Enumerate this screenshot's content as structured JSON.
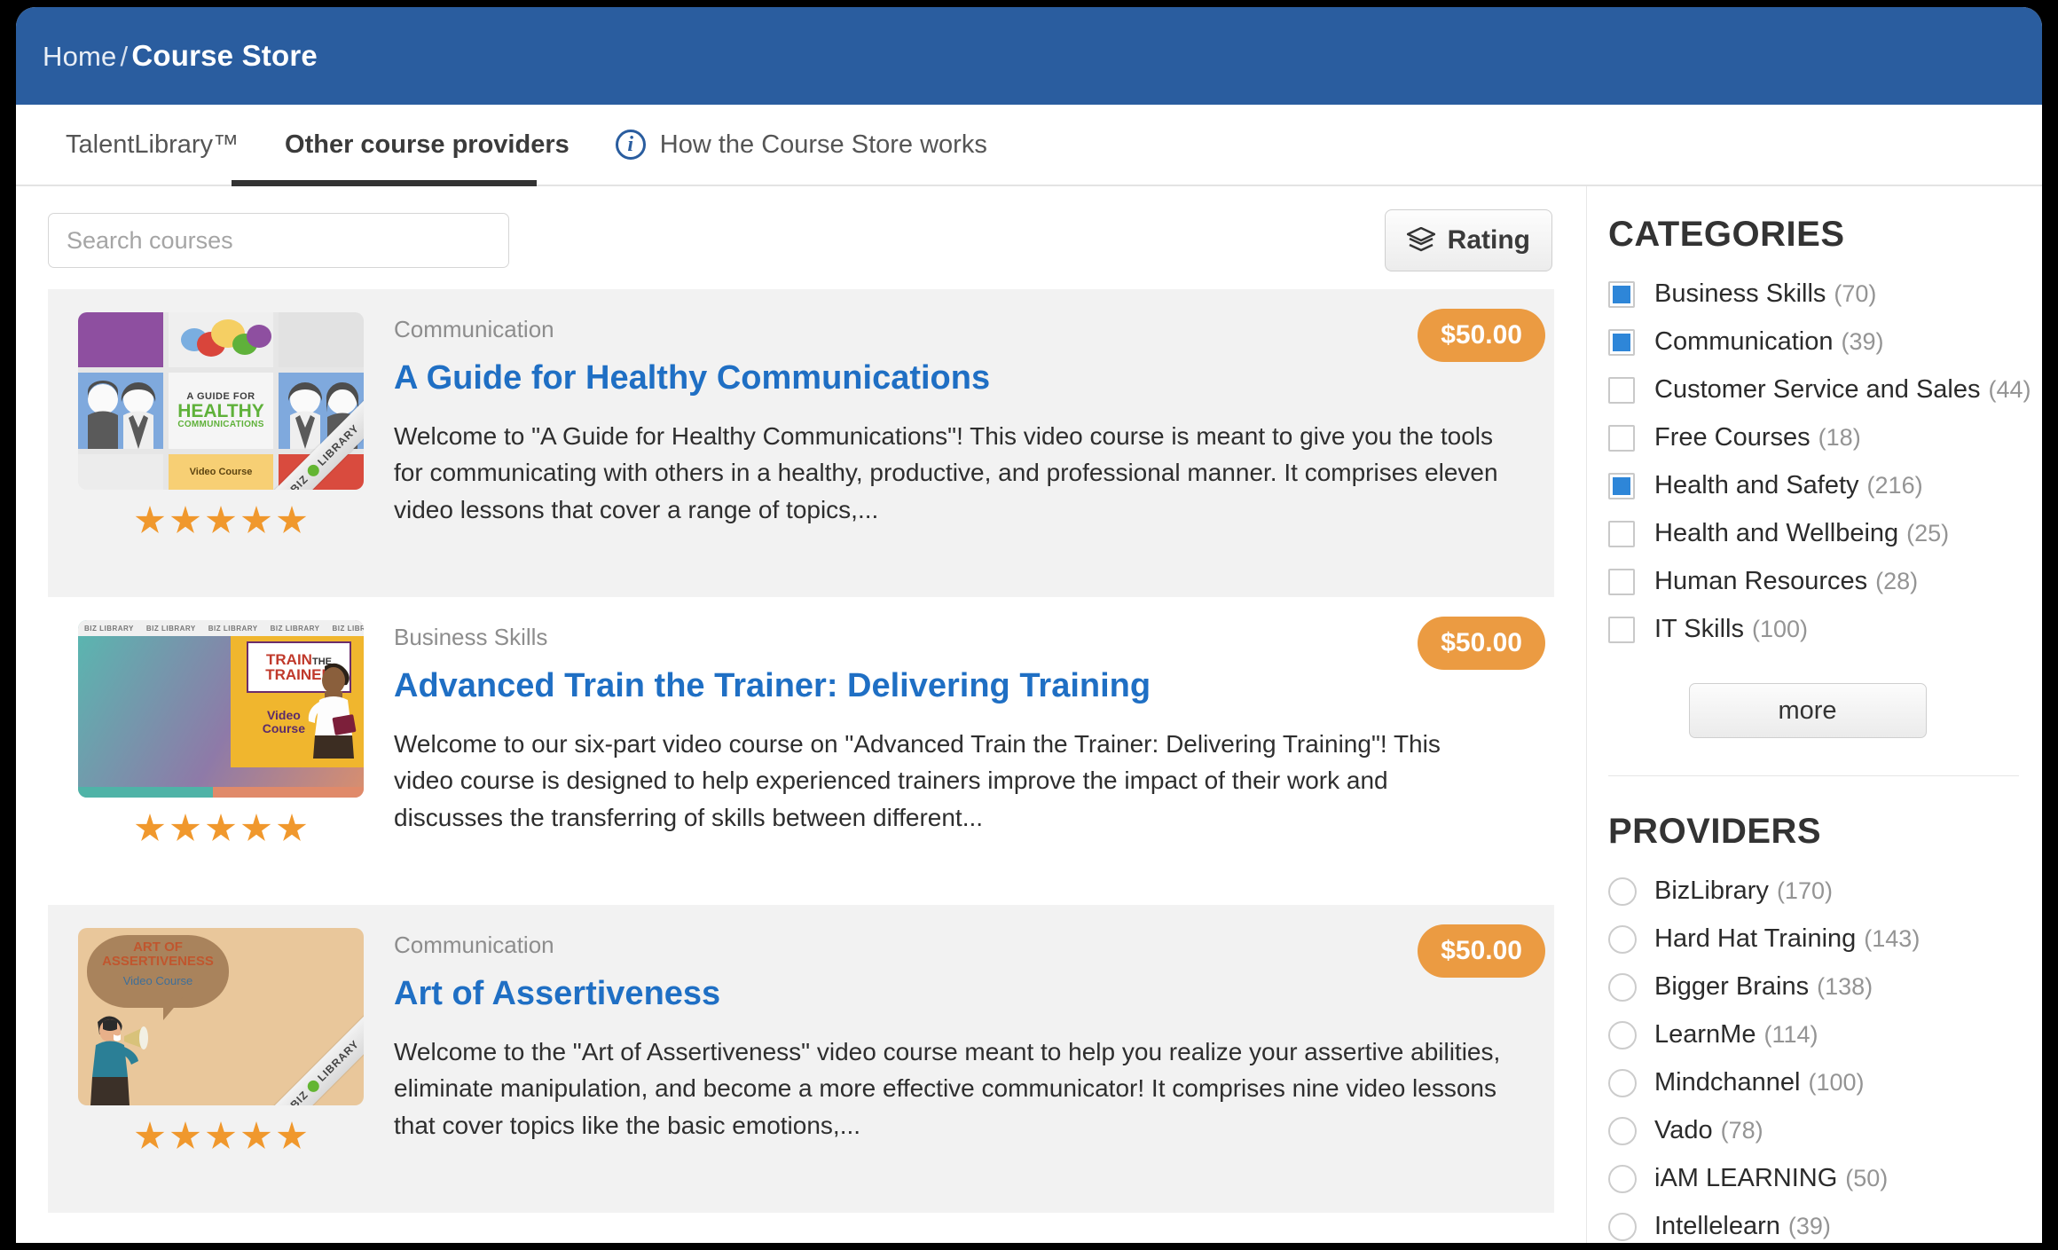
{
  "header": {
    "breadcrumb_home": "Home",
    "breadcrumb_separator": "/",
    "breadcrumb_current": "Course Store"
  },
  "tabs": [
    {
      "label": "TalentLibrary™",
      "active": false
    },
    {
      "label": "Other course providers",
      "active": true
    },
    {
      "label": "How the Course Store works",
      "active": false,
      "icon": "info-icon"
    }
  ],
  "toolbar": {
    "search_placeholder": "Search courses",
    "search_value": "",
    "sort_label": "Rating",
    "sort_icon": "layers-icon"
  },
  "courses": [
    {
      "category": "Communication",
      "title": "A Guide for Healthy Communications",
      "description": "Welcome to \"A Guide for Healthy Communications\"! This video course is meant to give you the tools for communicating with others in a healthy, productive, and professional manner. It comprises eleven video lessons that cover a range of topics,...",
      "price": "$50.00",
      "rating": 5,
      "thumb": {
        "heading_line1": "A GUIDE FOR",
        "heading_line2": "HEALTHY",
        "heading_line3": "COMMUNICATIONS",
        "badge": "Video Course",
        "ribbon": "LIBRARY",
        "ribbon_prefix": "BIZ"
      }
    },
    {
      "category": "Business Skills",
      "title": "Advanced Train the Trainer: Delivering Training",
      "description": "Welcome to our six-part video course on \"Advanced Train the Trainer: Delivering Training\"! This video course is designed to help experienced trainers improve the impact of their work and discusses the transferring of skills between different...",
      "price": "$50.00",
      "rating": 5,
      "thumb": {
        "heading_line1": "TRAIN",
        "heading_the": "THE",
        "heading_line2": "TRAINER",
        "badge_line1": "Video",
        "badge_line2": "Course",
        "band_text": "BIZ LIBRARY"
      }
    },
    {
      "category": "Communication",
      "title": "Art of Assertiveness",
      "description": "Welcome to the \"Art of Assertiveness\" video course meant to help you realize your assertive abilities, eliminate manipulation, and become a more effective communicator! It comprises nine video lessons that cover topics like the basic emotions,...",
      "price": "$50.00",
      "rating": 5,
      "thumb": {
        "heading_line1": "ART OF",
        "heading_line2": "ASSERTIVENESS",
        "badge": "Video Course",
        "ribbon": "LIBRARY",
        "ribbon_prefix": "BIZ"
      }
    }
  ],
  "sidebar": {
    "categories_title": "CATEGORIES",
    "categories": [
      {
        "label": "Business Skills",
        "count": "(70)",
        "checked": true
      },
      {
        "label": "Communication",
        "count": "(39)",
        "checked": true
      },
      {
        "label": "Customer Service and Sales",
        "count": "(44)",
        "checked": false
      },
      {
        "label": "Free Courses",
        "count": "(18)",
        "checked": false
      },
      {
        "label": "Health and Safety",
        "count": "(216)",
        "checked": true
      },
      {
        "label": "Health and Wellbeing",
        "count": "(25)",
        "checked": false
      },
      {
        "label": "Human Resources",
        "count": "(28)",
        "checked": false
      },
      {
        "label": "IT Skills",
        "count": "(100)",
        "checked": false
      }
    ],
    "more_label": "more",
    "providers_title": "PROVIDERS",
    "providers": [
      {
        "label": "BizLibrary",
        "count": "(170)",
        "selected": false
      },
      {
        "label": "Hard Hat Training",
        "count": "(143)",
        "selected": false
      },
      {
        "label": "Bigger Brains",
        "count": "(138)",
        "selected": false
      },
      {
        "label": "LearnMe",
        "count": "(114)",
        "selected": false
      },
      {
        "label": "Mindchannel",
        "count": "(100)",
        "selected": false
      },
      {
        "label": "Vado",
        "count": "(78)",
        "selected": false
      },
      {
        "label": "iAM LEARNING",
        "count": "(50)",
        "selected": false
      },
      {
        "label": "Intellelearn",
        "count": "(39)",
        "selected": false
      }
    ]
  },
  "colors": {
    "header_blue": "#2a5d9f",
    "link_blue": "#1f6fc4",
    "price_orange": "#eb9b42",
    "star_orange": "#f0982d",
    "checkbox_blue": "#2e86d8"
  }
}
